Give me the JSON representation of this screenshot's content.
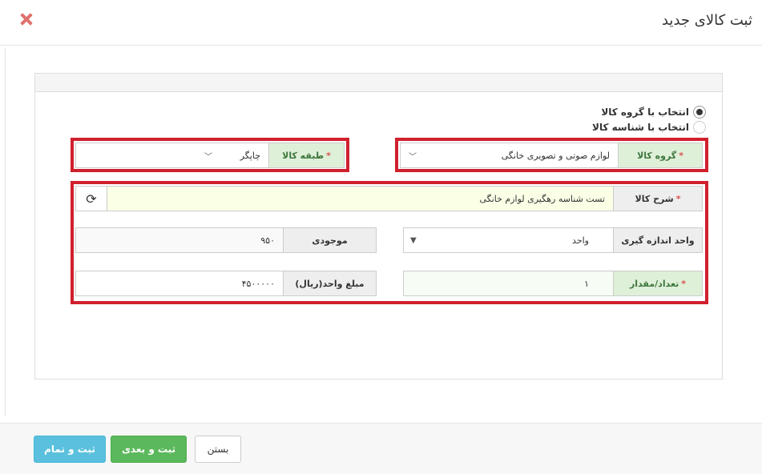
{
  "dialog": {
    "title": "ثبت کالای جدید"
  },
  "selection_mode": {
    "options": [
      {
        "label": "انتخاب با گروه کالا",
        "selected": true
      },
      {
        "label": "انتخاب با شناسه کالا",
        "selected": false
      }
    ]
  },
  "group_fields": {
    "product_group": {
      "label": "گروه کالا",
      "value": "لوازم صوتی و تصویری خانگی"
    },
    "product_category": {
      "label": "طبقه کالا",
      "value": "چاپگر"
    }
  },
  "details": {
    "description": {
      "label": "شرح کالا",
      "value": "تست شناسه رهگیری لوازم خانگی"
    },
    "unit": {
      "label": "واحد اندازه گیری",
      "value": "واحد"
    },
    "stock": {
      "label": "موجودی",
      "value": "۹۵۰"
    },
    "quantity": {
      "label": "تعداد/مقدار",
      "value": "۱"
    },
    "unit_price": {
      "label": "مبلغ واحد(ریال)",
      "value": "۴۵۰۰۰۰۰"
    }
  },
  "footer": {
    "save_finish_label": "ثبت و تمام",
    "save_next_label": "ثبت و بعدی",
    "close_label": "بستن"
  },
  "colors": {
    "highlight_border": "#d0202e",
    "required_label_bg": "#dff0d8",
    "save_finish_bg": "#5bc0de",
    "save_next_bg": "#5cb85c"
  },
  "icons": {
    "close": "close-icon",
    "refresh": "refresh-icon",
    "dropdown": "chevron-down-icon"
  }
}
